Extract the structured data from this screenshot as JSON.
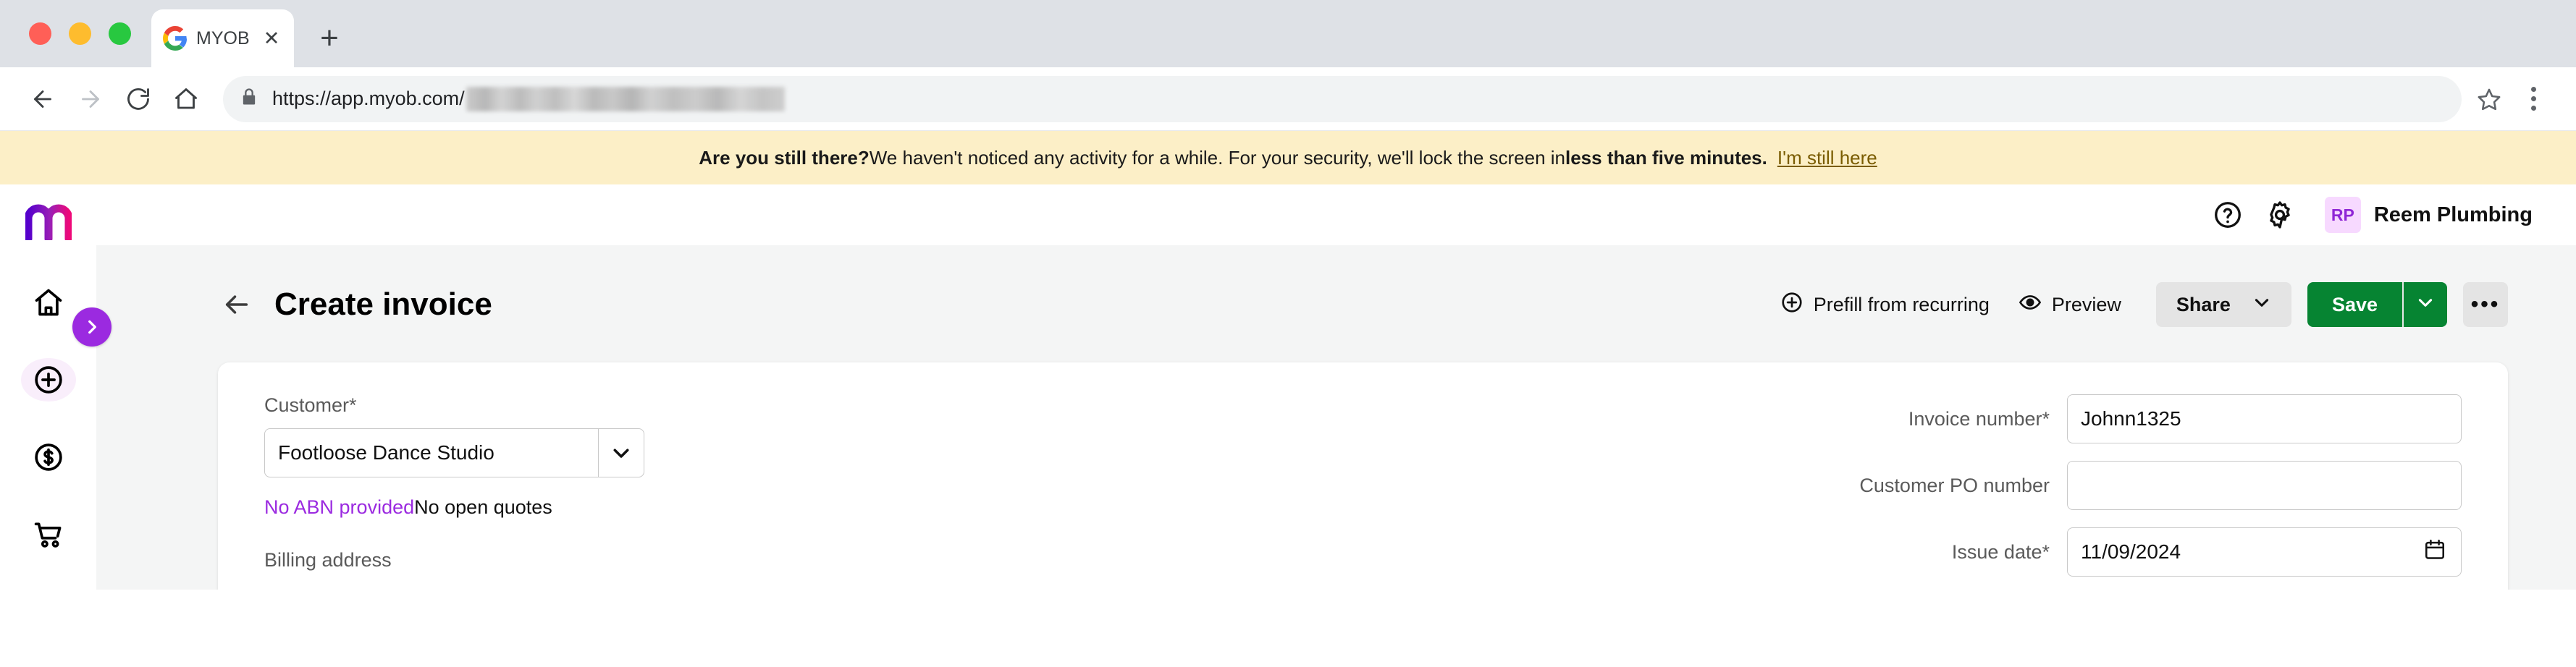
{
  "browser": {
    "tab": {
      "title": "MYOB",
      "favicon": "google-favicon",
      "close_label": "✕"
    },
    "new_tab_label": "+",
    "url_prefix": "https://app.myob.com/",
    "url_redacted": true,
    "nav": {
      "back": "back-arrow",
      "forward": "forward-arrow",
      "reload": "reload-icon",
      "home": "home-icon"
    },
    "lock_icon": "lock-icon",
    "bookmark_icon": "star-icon",
    "menu_icon": "kebab-menu-icon"
  },
  "banner": {
    "heading": "Are you still there?",
    "body": " We haven't noticed any activity for a while. For your security, we'll lock the screen in ",
    "emphasis": "less than five minutes.",
    "action_label": "I'm still here",
    "background": "#fcefc7",
    "link_color": "#7a5c00"
  },
  "sidebar": {
    "logo": "myob-logo",
    "toggle": {
      "name": "expand-sidebar",
      "icon": "chevron-right-icon",
      "color": "#9b2ae0"
    },
    "items": [
      {
        "icon": "home-icon",
        "label": "Home",
        "active": false
      },
      {
        "icon": "plus-circle-icon",
        "label": "Create",
        "active": true
      },
      {
        "icon": "dollar-circle-icon",
        "label": "Sales",
        "active": false
      },
      {
        "icon": "cart-icon",
        "label": "Purchases",
        "active": false
      }
    ]
  },
  "app_header": {
    "help_icon": "help-circle-icon",
    "settings_icon": "gear-icon",
    "avatar_initials": "RP",
    "avatar_bg": "#f7d9ff",
    "avatar_fg": "#8f26d6",
    "org_name": "Reem Plumbing"
  },
  "page": {
    "back_icon": "arrow-left-icon",
    "title": "Create invoice",
    "toolbar": {
      "prefill_label": "Prefill from recurring",
      "prefill_icon": "plus-circle-icon",
      "preview_label": "Preview",
      "preview_icon": "eye-icon",
      "share_label": "Share",
      "share_caret": "chevron-down-icon",
      "save_label": "Save",
      "save_caret": "chevron-down-icon",
      "more_label": "•••",
      "save_color": "#068432"
    }
  },
  "form": {
    "left": {
      "customer_label": "Customer",
      "customer_required": "*",
      "customer_value": "Footloose Dance Studio",
      "customer_caret": "chevron-down-icon",
      "hint_abn": "No ABN provided",
      "hint_quotes": "No open quotes",
      "abn_color": "#9b2ae0",
      "billing_address_label": "Billing address"
    },
    "right": {
      "invoice_number_label": "Invoice number",
      "invoice_number_required": "*",
      "invoice_number_value": "Johnn1325",
      "po_number_label": "Customer PO number",
      "po_number_value": "",
      "po_number_placeholder": "",
      "issue_date_label": "Issue date",
      "issue_date_required": "*",
      "issue_date_value": "11/09/2024",
      "calendar_icon": "calendar-icon"
    }
  }
}
